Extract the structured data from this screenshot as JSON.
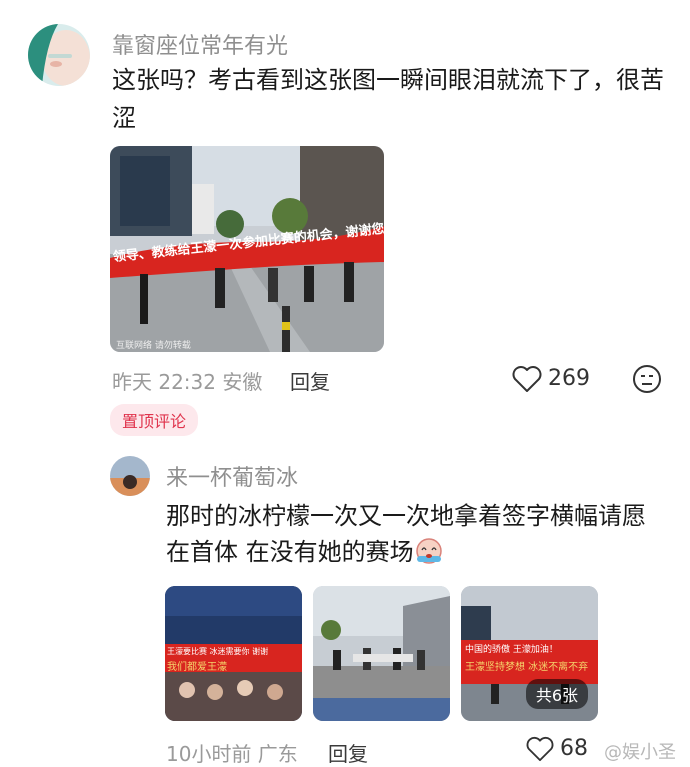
{
  "comment": {
    "username": "靠窗座位常年有光",
    "text_line1": "这张吗？考古看到这张图一瞬间眼泪就流下了，很苦",
    "text_line2": "涩",
    "photo_banner": "领导、教练给王濛一次参加比赛的机会，谢谢您们！",
    "photo_caption": "互联网络  请勿转载",
    "time_location": "昨天 22:32 安徽",
    "reply_label": "回复",
    "like_count": "269",
    "pin_label": "置顶评论"
  },
  "reply_comment": {
    "username": "来一杯葡萄冰",
    "text_line1": "那时的冰柠檬一次又一次地拿着签字横幅请愿",
    "text_line2": "在首体 在没有她的赛场",
    "photos": [
      {
        "banner_line1": "王濛要比赛  冰迷需要你  谢谢",
        "banner_line2": "我们都爱王濛"
      },
      {
        "banner_line1": ""
      },
      {
        "banner_line1": "中国的骄傲 王濛加油！",
        "banner_line2": "王濛坚持梦想 冰迷不离不弃"
      }
    ],
    "photo_count_badge": "共6张",
    "time_location": "10小时前 广东",
    "reply_label": "回复",
    "like_count": "68"
  },
  "watermark": "@娱小圣",
  "colors": {
    "accent_red": "#e0334c",
    "banner_red": "#d8251f",
    "text": "#1a1a1a",
    "meta": "#9a9a9a"
  }
}
